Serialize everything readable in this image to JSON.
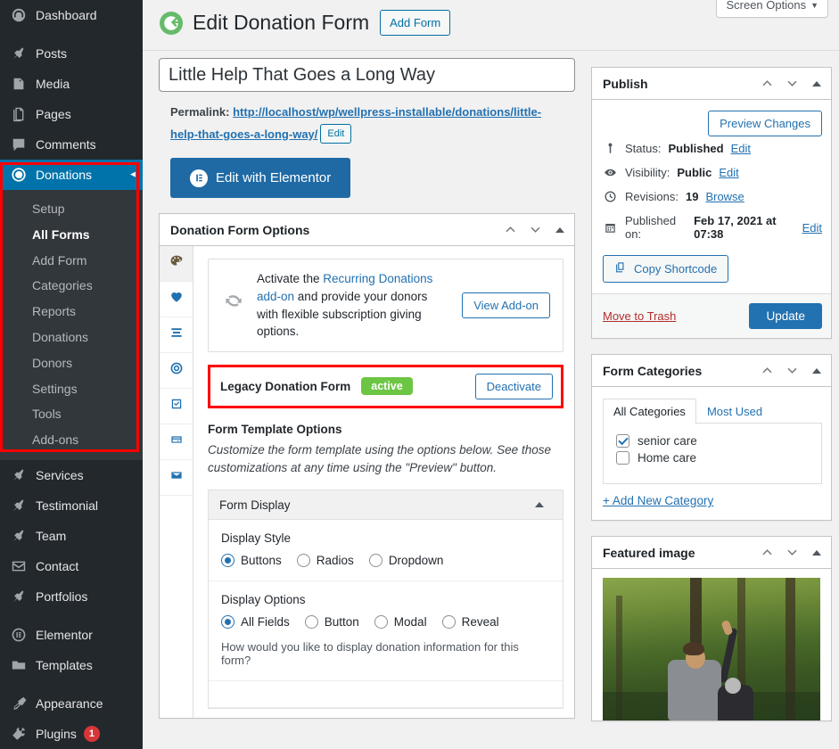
{
  "admin_menu": {
    "items": [
      {
        "label": "Dashboard",
        "icon": "dashboard-icon"
      },
      {
        "label": "Posts",
        "icon": "pin-icon"
      },
      {
        "label": "Media",
        "icon": "media-icon"
      },
      {
        "label": "Pages",
        "icon": "pages-icon"
      },
      {
        "label": "Comments",
        "icon": "comments-icon"
      }
    ],
    "current": {
      "label": "Donations",
      "icon": "give-icon"
    },
    "submenu": [
      {
        "label": "Setup",
        "active": false
      },
      {
        "label": "All Forms",
        "active": true
      },
      {
        "label": "Add Form",
        "active": false
      },
      {
        "label": "Categories",
        "active": false
      },
      {
        "label": "Reports",
        "active": false
      },
      {
        "label": "Donations",
        "active": false
      },
      {
        "label": "Donors",
        "active": false
      },
      {
        "label": "Settings",
        "active": false
      },
      {
        "label": "Tools",
        "active": false
      },
      {
        "label": "Add-ons",
        "active": false
      }
    ],
    "items_after": [
      {
        "label": "Services",
        "icon": "pin-icon"
      },
      {
        "label": "Testimonial",
        "icon": "pin-icon"
      },
      {
        "label": "Team",
        "icon": "pin-icon"
      },
      {
        "label": "Contact",
        "icon": "envelope-icon"
      },
      {
        "label": "Portfolios",
        "icon": "pin-icon"
      }
    ],
    "items_tools": [
      {
        "label": "Elementor",
        "icon": "elementor-icon"
      },
      {
        "label": "Templates",
        "icon": "folder-icon"
      }
    ],
    "items_bottom": [
      {
        "label": "Appearance",
        "icon": "brush-icon",
        "badge": ""
      },
      {
        "label": "Plugins",
        "icon": "plug-icon",
        "badge": "1"
      }
    ]
  },
  "screen_options": {
    "label": "Screen Options",
    "caret": "▼"
  },
  "header": {
    "title": "Edit Donation Form",
    "add_form_label": "Add Form",
    "logo_icon": "give-logo-icon"
  },
  "editor": {
    "title_value": "Little Help That Goes a Long Way",
    "permalink_label": "Permalink:",
    "permalink_url": "http://localhost/wp/wellpress-installable/donations/little-help-that-goes-a-long-way/",
    "permalink_edit_label": "Edit",
    "elementor_button": "Edit with Elementor"
  },
  "donation_form_options": {
    "panel_title": "Donation Form Options",
    "vtabs": [
      {
        "name": "palette-icon",
        "active": true
      },
      {
        "name": "heart-icon",
        "active": false
      },
      {
        "name": "list-icon",
        "active": false
      },
      {
        "name": "target-icon",
        "active": false
      },
      {
        "name": "checkbox-icon",
        "active": false
      },
      {
        "name": "wallet-icon",
        "active": false
      },
      {
        "name": "envelope-icon",
        "active": false
      }
    ],
    "addon_notice": {
      "text_before": "Activate the ",
      "link": "Recurring Donations add-on",
      "text_after": " and provide your donors with flexible subscription giving options.",
      "button": "View Add-on",
      "icon": "sync-icon"
    },
    "legacy": {
      "label": "Legacy Donation Form",
      "status": "active",
      "button": "Deactivate"
    },
    "template_options": {
      "title": "Form Template Options",
      "description": "Customize the form template using the options below. See those customizations at any time using the \"Preview\" button."
    },
    "form_display": {
      "section_title": "Form Display",
      "display_style": {
        "label": "Display Style",
        "options": [
          "Buttons",
          "Radios",
          "Dropdown"
        ],
        "selected": "Buttons"
      },
      "display_options": {
        "label": "Display Options",
        "options": [
          "All Fields",
          "Button",
          "Modal",
          "Reveal"
        ],
        "selected": "All Fields",
        "help": "How would you like to display donation information for this form?"
      }
    }
  },
  "publish_box": {
    "title": "Publish",
    "preview_label": "Preview Changes",
    "status_label": "Status:",
    "status_value": "Published",
    "status_edit": "Edit",
    "visibility_label": "Visibility:",
    "visibility_value": "Public",
    "visibility_edit": "Edit",
    "revisions_label": "Revisions:",
    "revisions_value": "19",
    "revisions_browse": "Browse",
    "published_label": "Published on:",
    "published_value": "Feb 17, 2021 at 07:38",
    "published_edit": "Edit",
    "copy_shortcode": "Copy Shortcode",
    "trash_label": "Move to Trash",
    "update_label": "Update"
  },
  "form_categories": {
    "title": "Form Categories",
    "tabs": [
      {
        "label": "All Categories",
        "active": true
      },
      {
        "label": "Most Used",
        "active": false
      }
    ],
    "categories": [
      {
        "label": "senior care",
        "checked": true
      },
      {
        "label": "Home care",
        "checked": false
      }
    ],
    "add_new": "+ Add New Category"
  },
  "featured_image": {
    "title": "Featured image"
  },
  "colors": {
    "admin_bg": "#23282d",
    "submenu_bg": "#32373c",
    "current_blue": "#0073aa",
    "link_blue": "#2271b1",
    "primary_blue": "#2271b1",
    "elementor_blue": "#1f6aa5",
    "active_green": "#6cc644",
    "annotation_red": "#ff0000",
    "trash_red": "#b32d2e",
    "badge_red": "#d63638"
  }
}
